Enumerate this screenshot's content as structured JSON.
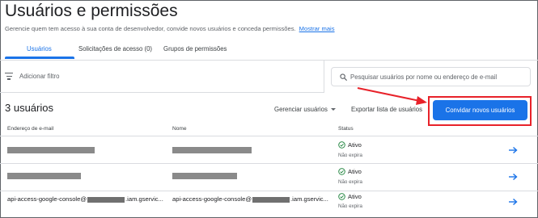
{
  "header": {
    "title": "Usuários e permissões",
    "subtitle": "Gerencie quem tem acesso à sua conta de desenvolvedor, convide novos usuários e conceda permissões.",
    "learn_more": "Mostrar mais"
  },
  "tabs": [
    {
      "label": "Usuários",
      "active": true
    },
    {
      "label": "Solicitações de acesso (0)",
      "active": false
    },
    {
      "label": "Grupos de permissões",
      "active": false
    }
  ],
  "filter": {
    "label": "Adicionar filtro",
    "icon": "filter-list-icon"
  },
  "search": {
    "placeholder": "Pesquisar usuários por nome ou endereço de e-mail",
    "icon": "search-icon"
  },
  "summary": {
    "count_label": "3 usuários",
    "manage_label": "Gerenciar usuários",
    "export_label": "Exportar lista de usuários",
    "invite_label": "Convidar novos usuários"
  },
  "table": {
    "columns": [
      "Endereço de e-mail",
      "Nome",
      "Status"
    ],
    "rows": [
      {
        "status": "Ativo",
        "status_sub": "Não expira"
      },
      {
        "status": "Ativo",
        "status_sub": "Não expira"
      },
      {
        "email_prefix": "api-access-google-console@",
        "email_suffix": ".iam.gservic...",
        "name_prefix": "api-access-google-console@",
        "name_suffix": ".iam.gservic...",
        "status": "Ativo",
        "status_sub": "Não expira"
      }
    ]
  },
  "colors": {
    "accent": "#1a73e8",
    "highlight": "#e8222a",
    "status_ok": "#188038"
  }
}
